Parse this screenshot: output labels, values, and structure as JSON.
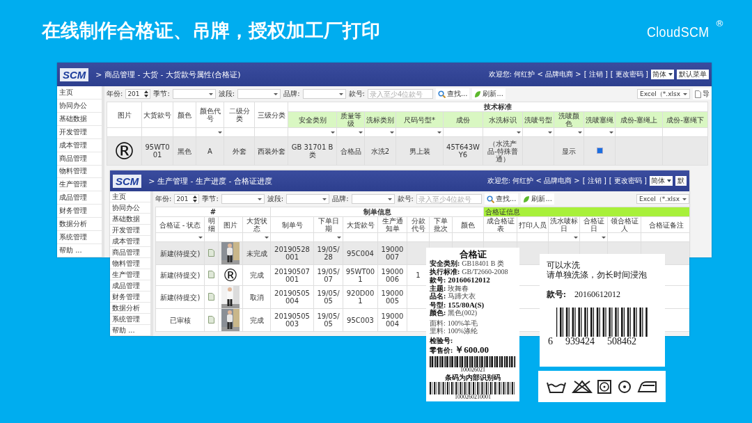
{
  "slide": {
    "title": "在线制作合格证、吊牌，授权加工厂打印",
    "brand": "CloudSCM",
    "brand_mark": "®"
  },
  "windows": [
    {
      "logo": "SCM",
      "breadcrumb": "> 商品管理 - 大货 - 大货款号属性(合格证)",
      "welcome": "欢迎您: 何红护 < 品牌电商 >",
      "links": [
        "[ 注销 ]",
        "[ 更改密码 ]"
      ],
      "language": "简体",
      "menu": "默认菜单",
      "sidebar": [
        "主页",
        "协同办公",
        "基础数据",
        "开发管理",
        "成本管理",
        "商品管理",
        "物料管理",
        "生产管理",
        "成品管理",
        "财务管理",
        "数据分析",
        "系统管理",
        "帮助 ..."
      ],
      "toolbar": {
        "fields": [
          {
            "label": "年份:",
            "kind": "spinner",
            "value": "201"
          },
          {
            "label": "季节:",
            "kind": "select"
          },
          {
            "label": "波段:",
            "kind": "select"
          },
          {
            "label": "品牌:",
            "kind": "select"
          },
          {
            "label": "款号:",
            "kind": "text",
            "placeholder": "录入至少4位款号"
          }
        ],
        "buttons": [
          "查找...",
          "刷新..."
        ],
        "export": "Excel（*.xlsx",
        "export_button": "导"
      },
      "groups": [
        {
          "kind": "plain",
          "columns": [
            {
              "label": "图片",
              "dropdown": false
            },
            {
              "label": "大货款号",
              "dropdown": false
            },
            {
              "label": "颜色",
              "dropdown": false
            },
            {
              "label": "颜色代号",
              "dropdown": true
            },
            {
              "label": "二级分类",
              "dropdown": false
            },
            {
              "label": "三级分类",
              "dropdown": false
            }
          ]
        },
        {
          "kind": "tinted-columns",
          "label": "技术标准",
          "columns": [
            {
              "label": "安全类别",
              "dropdown": true
            },
            {
              "label": "质量等级",
              "dropdown": true
            },
            {
              "label": "洗标类别",
              "dropdown": true
            },
            {
              "label": "尺码号型*",
              "dropdown": true
            },
            {
              "label": "成份",
              "dropdown": false
            },
            {
              "label": "水洗标识",
              "dropdown": true
            },
            {
              "label": "洗唛号型",
              "dropdown": true
            },
            {
              "label": "洗唛颜色",
              "dropdown": true
            },
            {
              "label": "洗唛塞绳",
              "dropdown": true
            },
            {
              "label": "成份-塞绳上",
              "dropdown": false
            },
            {
              "label": "成份-塞绳下",
              "dropdown": false
            }
          ]
        }
      ],
      "rows": [
        {
          "selected": true,
          "cells": [
            {
              "kind": "symbol",
              "text": "®"
            },
            "95WT001",
            "黑色",
            "A",
            "外套",
            "西装外套",
            "GB 31701 B类",
            "合格品",
            "水洗2",
            "男上装",
            "45T643WY6",
            "（水洗产品-特殊普通）",
            null,
            "显示",
            {
              "kind": "checkbox",
              "checked": true
            },
            null,
            null
          ]
        }
      ]
    },
    {
      "logo": "SCM",
      "breadcrumb": "> 生产管理 - 生产进度 - 合格证进度",
      "welcome": "欢迎您: 何红护 < 品牌电商 >",
      "links": [
        "[ 注销 ]",
        "[ 更改密码 ]"
      ],
      "language": "简体",
      "menu": "默",
      "sidebar": [
        "主页",
        "协同办公",
        "基础数据",
        "开发管理",
        "成本管理",
        "商品管理",
        "物料管理",
        "生产管理",
        "成品管理",
        "财务管理",
        "数据分析",
        "系统管理",
        "帮助 ..."
      ],
      "toolbar": {
        "fields": [
          {
            "label": "年份:",
            "kind": "spinner",
            "value": "201"
          },
          {
            "label": "季节:",
            "kind": "select"
          },
          {
            "label": "波段:",
            "kind": "select"
          },
          {
            "label": "品牌:",
            "kind": "select"
          },
          {
            "label": "款号:",
            "kind": "text",
            "placeholder": "录入至少4位款号"
          }
        ],
        "buttons": [
          "查找...",
          "刷新..."
        ],
        "export": "Excel（*.xlsx"
      },
      "groups": [
        {
          "kind": "plain-labelled",
          "label": "#",
          "columns": [
            {
              "label": "合格证 - 状态",
              "dropdown": true
            },
            {
              "label": "明细",
              "dropdown": false
            },
            {
              "label": "图片",
              "dropdown": false
            },
            {
              "label": "大货状态",
              "dropdown": true
            }
          ]
        },
        {
          "kind": "plain-labelled",
          "label": "制单信息",
          "columns": [
            {
              "label": "制单号",
              "dropdown": false
            },
            {
              "label": "下单日期",
              "dropdown": true
            },
            {
              "label": "大货款号",
              "dropdown": false
            },
            {
              "label": "生产通知单",
              "dropdown": false
            },
            {
              "label": "分款代号",
              "dropdown": false
            },
            {
              "label": "下单批次",
              "dropdown": false
            },
            {
              "label": "颜色",
              "dropdown": false
            }
          ]
        },
        {
          "kind": "highlight",
          "label": "合格证信息",
          "columns": [
            {
              "label": "成合格证表",
              "dropdown": false
            },
            {
              "label": "打印人员",
              "dropdown": false
            },
            {
              "label": "洗水唛标日",
              "dropdown": true
            },
            {
              "label": "合格证日",
              "dropdown": true
            },
            {
              "label": "领合格证人",
              "dropdown": false
            },
            {
              "label": "合格证备注",
              "dropdown": false
            }
          ]
        }
      ],
      "rows": [
        {
          "selected": true,
          "cells": [
            "新建(待提交)",
            {
              "kind": "doc-icon"
            },
            {
              "kind": "picture"
            },
            "未完成",
            "20190528001",
            "19/05/28",
            "95C004",
            "19000007",
            null,
            null,
            null,
            null,
            null,
            null,
            null,
            null,
            null
          ]
        },
        {
          "selected": false,
          "cells": [
            "新建(待提交)",
            {
              "kind": "doc-icon"
            },
            {
              "kind": "symbol",
              "text": "®"
            },
            "完成",
            "20190507001",
            "19/05/07",
            "95WT001",
            "19000006",
            "1",
            null,
            null,
            null,
            null,
            null,
            null,
            null,
            null
          ]
        },
        {
          "selected": false,
          "cells": [
            "新建(待提交)",
            {
              "kind": "doc-icon"
            },
            {
              "kind": "picture"
            },
            "取消",
            "20190505004",
            "19/05/05",
            "920D001",
            "19000005",
            null,
            null,
            null,
            null,
            null,
            null,
            null,
            null,
            null
          ]
        },
        {
          "selected": false,
          "cells": [
            "已审核",
            {
              "kind": "doc-icon"
            },
            {
              "kind": "picture"
            },
            "完成",
            "20190505003",
            "19/05/05",
            "95C003",
            "19000004",
            null,
            null,
            null,
            null,
            null,
            null,
            null,
            null,
            null
          ]
        }
      ]
    }
  ],
  "certificate": {
    "title": "合格证",
    "fields": [
      {
        "label": "安全类别:",
        "value": "GB18401 B 类",
        "kind": "small"
      },
      {
        "label": "执行标准:",
        "value": "GB/T2660-2008",
        "kind": "small"
      },
      {
        "label": "款号:",
        "value": "20160612012",
        "kind": "large"
      },
      {
        "label": "主题:",
        "value": "玫舞春",
        "kind": "small"
      },
      {
        "label": "品名:",
        "value": "马蹄大衣",
        "kind": "small"
      },
      {
        "label": "号型:",
        "value": "155/80A(S)",
        "kind": "large"
      },
      {
        "label": "颜色:",
        "value": "黑色(002)",
        "kind": "small"
      }
    ],
    "materials": [
      {
        "label": "面料:",
        "value": "100%羊毛"
      },
      {
        "label": "里料:",
        "value": "100%涤纶"
      }
    ],
    "inspection_label": "检验号:",
    "price_label": "零售价:",
    "price": "￥600.00",
    "barcode_number": "100026021",
    "barcode_note": "条码为内部识别码",
    "barcode_number_2": "1000260210001"
  },
  "hang_tag": {
    "lines": [
      "可以水洗",
      "请单独洗涤，勿长时间浸泡"
    ],
    "style_label": "款号:",
    "style_number": "20160612012",
    "barcode_digits": [
      "6",
      "939424",
      "508462"
    ]
  },
  "care_label": {
    "symbols": [
      {
        "kind": "wash"
      },
      {
        "kind": "no-bleach"
      },
      {
        "kind": "tumble-dry"
      },
      {
        "kind": "dry-clean"
      },
      {
        "kind": "iron"
      }
    ]
  }
}
